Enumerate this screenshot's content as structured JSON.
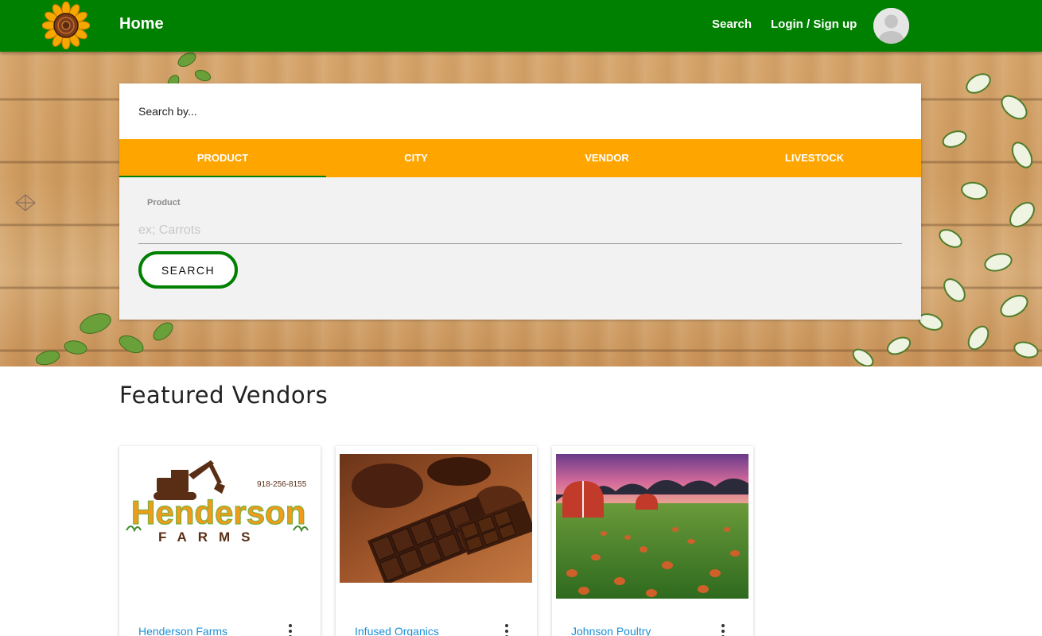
{
  "navbar": {
    "home_label": "Home",
    "search_label": "Search",
    "login_label": "Login / Sign up",
    "colors": {
      "background": "#008000",
      "text": "#ffffff"
    },
    "logo_icon": "sunflower-icon",
    "avatar_icon": "user-avatar-icon"
  },
  "search": {
    "heading": "Search by...",
    "tabs": [
      {
        "label": "PRODUCT",
        "active": true
      },
      {
        "label": "CITY",
        "active": false
      },
      {
        "label": "VENDOR",
        "active": false
      },
      {
        "label": "LIVESTOCK",
        "active": false
      }
    ],
    "field_label": "Product",
    "field_placeholder": "ex; Carrots",
    "field_value": "",
    "button_label": "SEARCH",
    "colors": {
      "tab_bar": "#FFA500",
      "active_indicator": "#008000",
      "button_border": "#008000"
    }
  },
  "featured": {
    "title": "Featured Vendors",
    "vendors": [
      {
        "name": "Henderson Farms",
        "logo_text_1": "Henderson",
        "logo_text_2": "FARMS",
        "logo_phone": "918-256-8155"
      },
      {
        "name": "Infused Organics"
      },
      {
        "name": "Johnson Poultry"
      }
    ],
    "link_color": "#1a8fd6"
  }
}
